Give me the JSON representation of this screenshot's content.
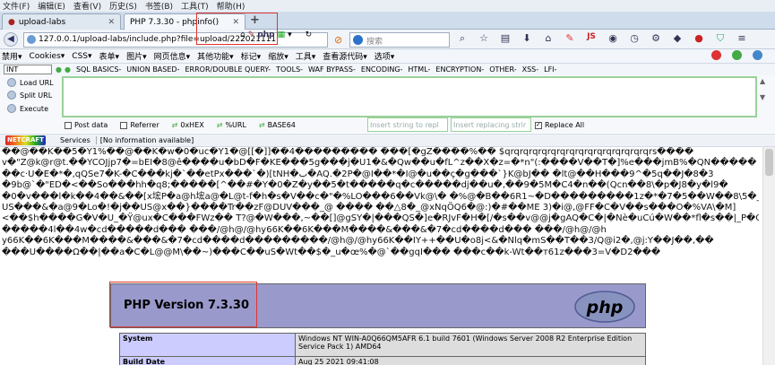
{
  "menubar": {
    "items": [
      "文件(F)",
      "编辑(E)",
      "查看(V)",
      "历史(S)",
      "书签(B)",
      "工具(T)",
      "帮助(H)"
    ]
  },
  "tabs": [
    {
      "title": "upload-labs",
      "active": false
    },
    {
      "title": "PHP 7.3.30 - phpinfo()",
      "active": true
    }
  ],
  "navbar": {
    "url": "127.0.0.1/upload-labs/include.php?file=upload/222021111",
    "search_placeholder": "搜索"
  },
  "toolbar2": {
    "items": [
      "禁用▾",
      "Cookies▾",
      "CSS▾",
      "表单▾",
      "图片▾",
      "网页信息▾",
      "其他功能▾",
      "标记▾",
      "缩放▾",
      "工具▾",
      "查看源代码▾",
      "选项▾"
    ]
  },
  "hackbar": {
    "select_value": "INT",
    "items": [
      "SQL BASICS-",
      "UNION BASED-",
      "ERROR/DOUBLE QUERY-",
      "TOOLS-",
      "WAF BYPASS-",
      "ENCODING-",
      "HTML-",
      "ENCRYPTION-",
      "OTHER-",
      "XSS-",
      "LFI-"
    ],
    "load_url": "Load URL",
    "split_url": "Split URL",
    "execute": "Execute",
    "post_data": "Post data",
    "referrer": "Referrer",
    "hex": "0xHEX",
    "url_btn": "%URL",
    "base64": "BASE64",
    "insert_placeholder": "Insert string to repl",
    "replace_placeholder": "Insert replacing strir",
    "replace_all": "Replace All"
  },
  "statusbar": {
    "netcraft": "NETCRAFT",
    "services": "Services",
    "info": "[No information available]"
  },
  "garbled_lines": [
    "  ��@��K��5�Y1%��@��K�w�0�uc�Y1�@[[�]]��4��������� ���[�gZ����%�� $qrqrqrqrqrqrqrqrqrqrqrqrqrqrqrqrs����",
    "v�\"Z@k@r@t.��YCOJjp7�=bEI�8@ê����u�bD�F�KE���5g���j�U1�&�Qw��u�fL^z��X�z=�*n\"(:����V��T�]%e���jmB%�QN�����",
    "��c·U�E�*�,qQSe7�K-�C���kj�`��etPx���`�)[tNH�ب�AQ.�2P�@I��*�I@�u��ç�g���`}K@bJ��  �lt@��H���9^�5q��J�8�3",
    "�9b@`�\"ED�<��So���hh�q8;�����[^��#�Y�0�Z�y��5�t�����q�c�����dj��u�,��9�5M�C4�n��(Qcn��8\\�p�J8�y�l9�",
    "�0�v���l�k��4��&��[x㙆P�a@h㙆a@�L@t-f�h�s�V��c�\"�%LO���6��Vk@\\�  �%@�B��6R1~�D���������1z�*�7�5��W��8\\5�_@ei�~",
    "US���&�a@9�Lo�!�j��US@x��}����Tr��zF@DUV���_@ ���� ��△8�_@xNqÖQ6�@:)�#��ME 3)�i@,@FF�C�V��s���O�%VA\\�M]",
    "<��$h����G�V�U_�Ÿ@ux�C���FWz�� T?@�W���,~��[]@gSY�|���QS�]e�RJvF�H�[/�s��v@@j�gAQ�C�|�Nè�uCú�W��*fl�s��|_P�Q�",
    "�����4l��4w�cd�����d��� ���/@h@/@hy66K��6K���M����&���&�7�cd����d��� ���/@h@/@h",
    "y66K��6K���M����&���&�7�cd����d���������/@h@/@hy66K��IY++��U�o8j<&�Nlq�mS��T��3/Q@i2�,@j:Y��J��,��",
    "���U����Ω��|��a�C�L@@M\\��~)���C��uS�Wt��$�_u�œ%�@`��gqI��� ���c��k-Wt��т61z���3=V�D2���"
  ],
  "phpinfo": {
    "title": "PHP Version 7.3.30",
    "logo_text": "php",
    "rows": [
      {
        "key": "System",
        "value": "Windows NT WIN-A0Q66QM5AFR 6.1 build 7601 (Windows Server 2008 R2 Enterprise Edition Service Pack 1) AMD64"
      },
      {
        "key": "Build Date",
        "value": "Aug 25 2021 09:41:08"
      }
    ]
  },
  "colors": {
    "php_header": "#9999cc",
    "table_key": "#ccccff",
    "table_val": "#dddddd",
    "annotation": "#e0342f"
  }
}
